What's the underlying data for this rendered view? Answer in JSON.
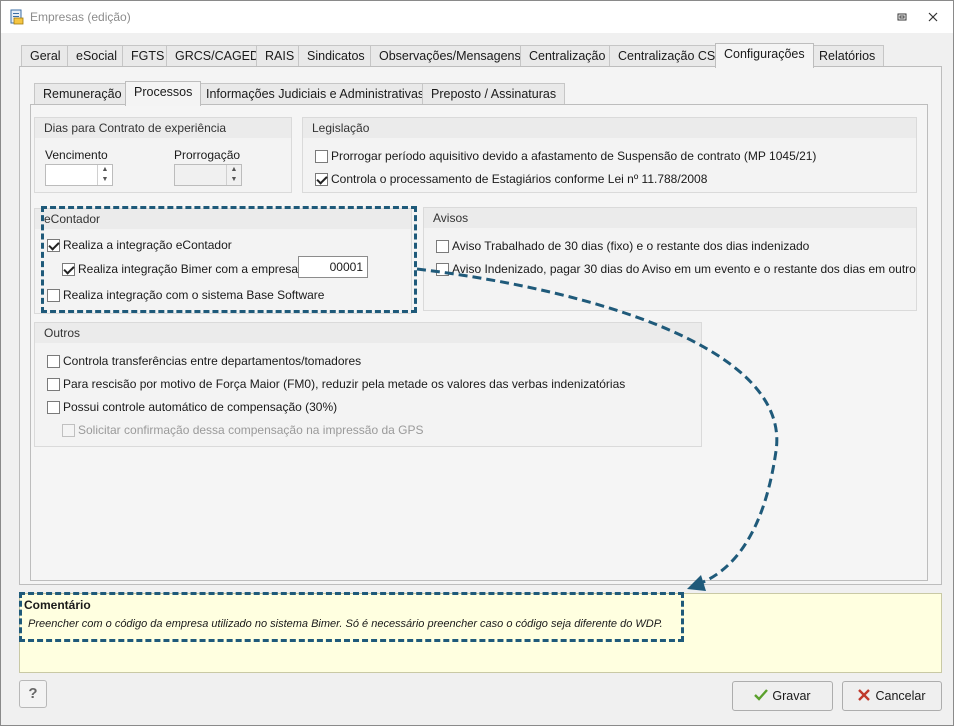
{
  "window": {
    "title": "Empresas (edição)"
  },
  "main_tabs": [
    {
      "label": "Geral"
    },
    {
      "label": "eSocial"
    },
    {
      "label": "FGTS"
    },
    {
      "label": "GRCS/CAGED"
    },
    {
      "label": "RAIS"
    },
    {
      "label": "Sindicatos"
    },
    {
      "label": "Observações/Mensagens"
    },
    {
      "label": "Centralização"
    },
    {
      "label": "Centralização CS"
    },
    {
      "label": "Configurações",
      "active": true
    },
    {
      "label": "Relatórios"
    }
  ],
  "sub_tabs": [
    {
      "label": "Remuneração"
    },
    {
      "label": "Processos",
      "active": true
    },
    {
      "label": "Informações Judiciais e Administrativas"
    },
    {
      "label": "Preposto / Assinaturas"
    }
  ],
  "contrato": {
    "title": "Dias para Contrato de experiência",
    "vencimento_label": "Vencimento",
    "vencimento_value": "",
    "prorrogacao_label": "Prorrogação",
    "prorrogacao_value": ""
  },
  "legislacao": {
    "title": "Legislação",
    "item1": {
      "label": "Prorrogar período aquisitivo devido a afastamento de Suspensão de contrato (MP 1045/21)",
      "checked": false
    },
    "item2": {
      "label": "Controla o processamento de Estagiários conforme Lei nº 11.788/2008",
      "checked": true
    }
  },
  "econtador": {
    "title": "eContador",
    "item1": {
      "label": "Realiza a integração eContador",
      "checked": true
    },
    "item2": {
      "label": "Realiza integração Bimer com a empresa:",
      "checked": true
    },
    "empresa_value": "00001",
    "item3": {
      "label": "Realiza integração com o sistema Base Software",
      "checked": false
    }
  },
  "avisos": {
    "title": "Avisos",
    "item1": {
      "label": "Aviso Trabalhado de 30 dias (fixo) e o restante dos dias indenizado",
      "checked": false
    },
    "item2": {
      "label": "Aviso Indenizado, pagar 30 dias do Aviso em um evento e o restante dos dias em outro",
      "checked": false
    }
  },
  "outros": {
    "title": "Outros",
    "item1": {
      "label": "Controla transferências entre departamentos/tomadores",
      "checked": false
    },
    "item2": {
      "label": "Para rescisão por motivo de Força Maior (FM0), reduzir pela metade os valores das verbas indenizatórias",
      "checked": false
    },
    "item3": {
      "label": "Possui controle automático de compensação (30%)",
      "checked": false
    },
    "item4": {
      "label": "Solicitar confirmação dessa compensação na impressão da GPS",
      "checked": false,
      "disabled": true
    }
  },
  "comment": {
    "title": "Comentário",
    "text": "Preencher com o código da empresa utilizado no sistema Bimer. Só é necessário preencher caso o código seja diferente do WDP."
  },
  "buttons": {
    "help": "?",
    "save": "Gravar",
    "cancel": "Cancelar"
  },
  "colors": {
    "annotation": "#1f5a7a",
    "save_check": "#5aa02c",
    "cancel_x": "#c0392b"
  }
}
